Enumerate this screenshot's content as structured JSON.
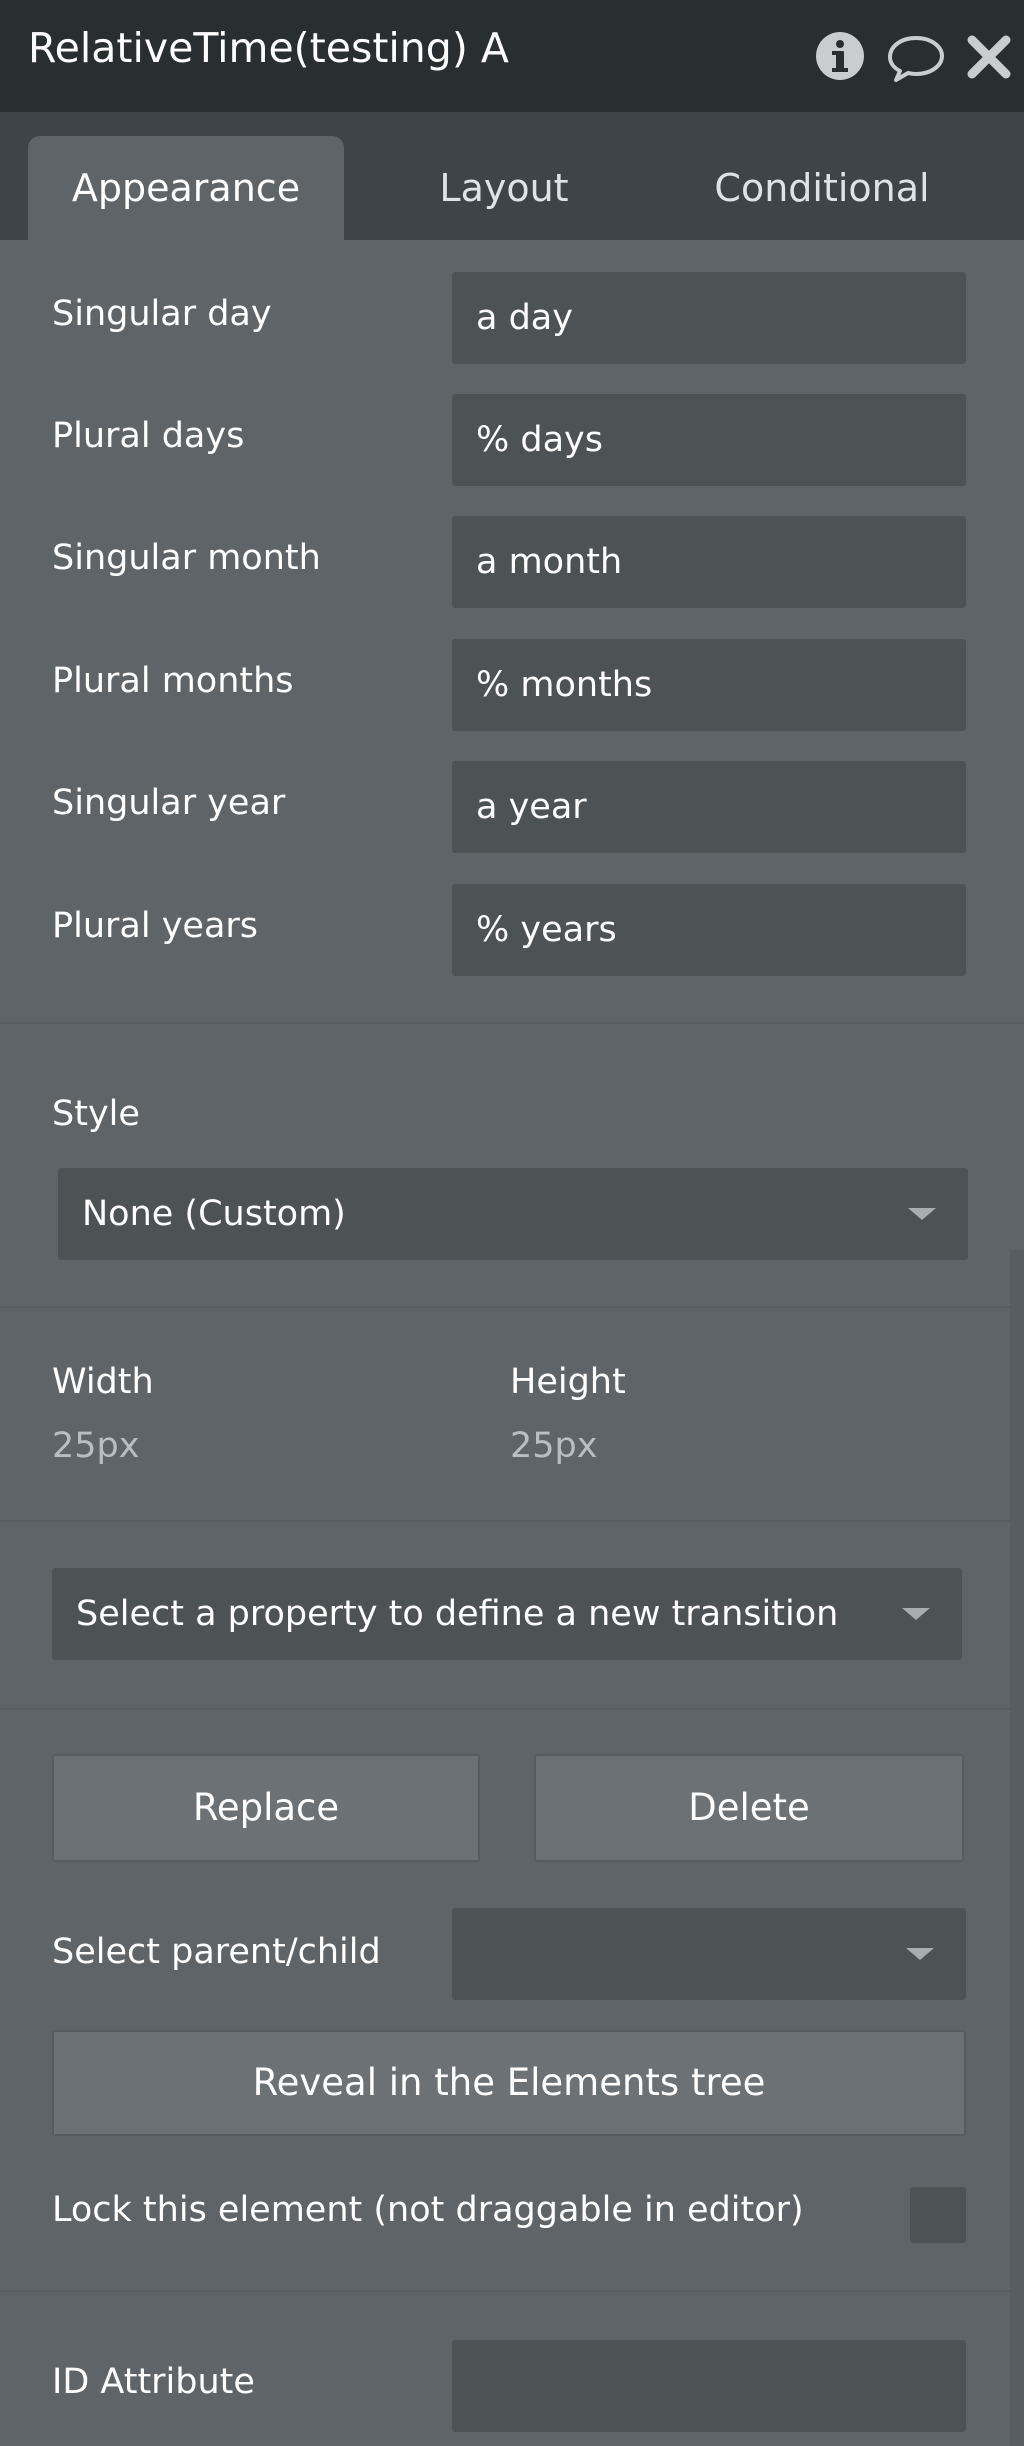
{
  "header": {
    "title": "RelativeTime(testing) A",
    "icons": [
      "info-icon",
      "comment-icon",
      "close-icon"
    ]
  },
  "tabs": [
    {
      "label": "Appearance",
      "active": true
    },
    {
      "label": "Layout",
      "active": false
    },
    {
      "label": "Conditional",
      "active": false
    }
  ],
  "fields": [
    {
      "label": "Singular day",
      "value": "a day"
    },
    {
      "label": "Plural days",
      "value": "% days"
    },
    {
      "label": "Singular month",
      "value": "a month"
    },
    {
      "label": "Plural months",
      "value": "% months"
    },
    {
      "label": "Singular year",
      "value": "a year"
    },
    {
      "label": "Plural years",
      "value": "% years"
    }
  ],
  "style": {
    "label": "Style",
    "value": "None (Custom)"
  },
  "size": {
    "width_label": "Width",
    "width_value": "25px",
    "height_label": "Height",
    "height_value": "25px"
  },
  "transition": {
    "placeholder": "Select a property to define a new transition"
  },
  "actions": {
    "replace_label": "Replace",
    "delete_label": "Delete"
  },
  "parent_child": {
    "label": "Select parent/child",
    "value": ""
  },
  "reveal": {
    "label": "Reveal in the Elements tree"
  },
  "lock": {
    "label": "Lock this element (not draggable in editor)",
    "checked": false
  },
  "id_attribute": {
    "label": "ID Attribute",
    "value": ""
  },
  "colors": {
    "header_bg": "#292e31",
    "tabbar_bg": "#3e4447",
    "panel_bg": "#5f6468",
    "field_bg": "#4d5255",
    "button_bg": "#6c7175"
  }
}
